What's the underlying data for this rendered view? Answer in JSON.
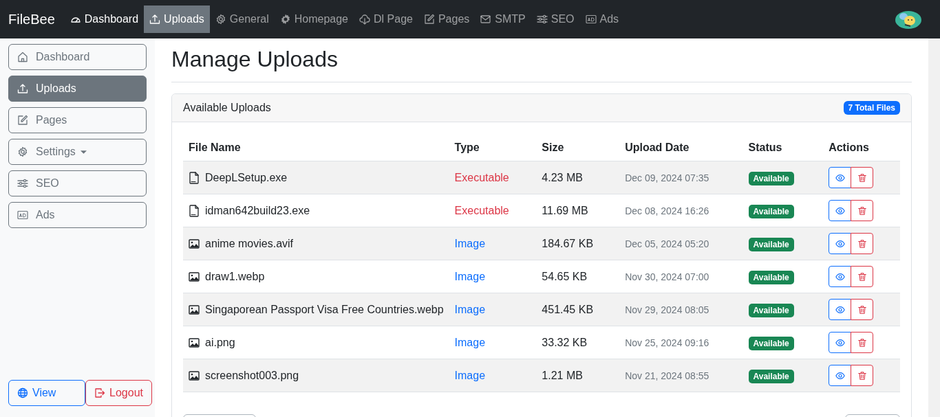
{
  "navbar": {
    "brand": "FileBee",
    "items": [
      {
        "label": "Dashboard",
        "selected": false,
        "emphasis": true
      },
      {
        "label": "Uploads",
        "selected": true,
        "emphasis": true
      },
      {
        "label": "General",
        "selected": false,
        "emphasis": false
      },
      {
        "label": "Homepage",
        "selected": false,
        "emphasis": false
      },
      {
        "label": "Dl Page",
        "selected": false,
        "emphasis": false
      },
      {
        "label": "Pages",
        "selected": false,
        "emphasis": false
      },
      {
        "label": "SMTP",
        "selected": false,
        "emphasis": false
      },
      {
        "label": "SEO",
        "selected": false,
        "emphasis": false
      },
      {
        "label": "Ads",
        "selected": false,
        "emphasis": false
      }
    ]
  },
  "sidebar": {
    "items": [
      {
        "label": "Dashboard",
        "selected": false,
        "dropdown": false
      },
      {
        "label": "Uploads",
        "selected": true,
        "dropdown": false
      },
      {
        "label": "Pages",
        "selected": false,
        "dropdown": false
      },
      {
        "label": "Settings",
        "selected": false,
        "dropdown": true
      },
      {
        "label": "SEO",
        "selected": false,
        "dropdown": false
      },
      {
        "label": "Ads",
        "selected": false,
        "dropdown": false
      }
    ],
    "buttons": [
      {
        "label": "View",
        "kind": "primary"
      },
      {
        "label": "Logout",
        "kind": "danger"
      }
    ]
  },
  "page_title": "Manage Uploads",
  "card": {
    "title": "Available Uploads",
    "badge": "7 Total Files",
    "table": {
      "columns": [
        "File Name",
        "Type",
        "Size",
        "Upload Date",
        "Status",
        "Actions"
      ],
      "rows": [
        {
          "name": "DeepLSetup.exe",
          "kind": "executable",
          "type": "Executable",
          "size": "4.23 MB",
          "date": "Dec 09, 2024 07:35",
          "status": "Available"
        },
        {
          "name": "idman642build23.exe",
          "kind": "executable",
          "type": "Executable",
          "size": "11.69 MB",
          "date": "Dec 08, 2024 16:26",
          "status": "Available"
        },
        {
          "name": "anime movies.avif",
          "kind": "image",
          "type": "Image",
          "size": "184.67 KB",
          "date": "Dec 05, 2024 05:20",
          "status": "Available"
        },
        {
          "name": "draw1.webp",
          "kind": "image",
          "type": "Image",
          "size": "54.65 KB",
          "date": "Nov 30, 2024 07:00",
          "status": "Available"
        },
        {
          "name": "Singaporean Passport Visa Free Countries.webp",
          "kind": "image",
          "type": "Image",
          "size": "451.45 KB",
          "date": "Nov 29, 2024 08:05",
          "status": "Available"
        },
        {
          "name": "ai.png",
          "kind": "image",
          "type": "Image",
          "size": "33.32 KB",
          "date": "Nov 25, 2024 09:16",
          "status": "Available"
        },
        {
          "name": "screenshot003.png",
          "kind": "image",
          "type": "Image",
          "size": "1.21 MB",
          "date": "Nov 21, 2024 08:55",
          "status": "Available"
        }
      ]
    }
  }
}
